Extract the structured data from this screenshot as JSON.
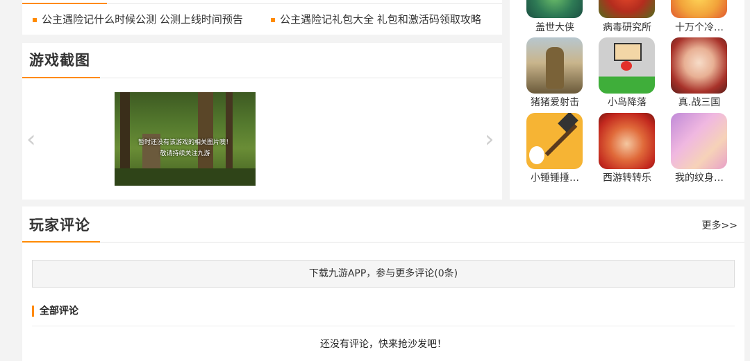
{
  "news": {
    "items": [
      {
        "text": "公主遇险记什么时候公测 公测上线时间预告"
      },
      {
        "text": "公主遇险记礼包大全 礼包和激活码领取攻略"
      }
    ]
  },
  "screenshots": {
    "title": "游戏截图",
    "placeholder_line1": "暂时还没有该游戏的相关图片噢！",
    "placeholder_line2": "敬请持续关注九游",
    "prev_arrow": "‹",
    "next_arrow": "›"
  },
  "games": [
    {
      "name": "盖世大侠",
      "icon": "hero-game-icon"
    },
    {
      "name": "病毒研究所",
      "icon": "virus-lab-game-icon"
    },
    {
      "name": "十万个冷…",
      "icon": "jokes-game-icon"
    },
    {
      "name": "猪猪爱射击",
      "icon": "soldier-game-icon"
    },
    {
      "name": "小鸟降落",
      "icon": "bird-game-icon"
    },
    {
      "name": "真.战三国",
      "icon": "three-kingdoms-game-icon"
    },
    {
      "name": "小锤锤捶…",
      "icon": "hammer-game-icon"
    },
    {
      "name": "西游转转乐",
      "icon": "journey-west-game-icon"
    },
    {
      "name": "我的纹身…",
      "icon": "tattoo-game-icon"
    }
  ],
  "comments": {
    "title": "玩家评论",
    "more": "更多>>",
    "download_bar": "下载九游APP，参与更多评论(0条)",
    "all_label": "全部评论",
    "empty_text": "还没有评论，快来抢沙发吧！"
  },
  "colors": {
    "accent": "#ff8a00",
    "background": "#f3f3f3"
  }
}
